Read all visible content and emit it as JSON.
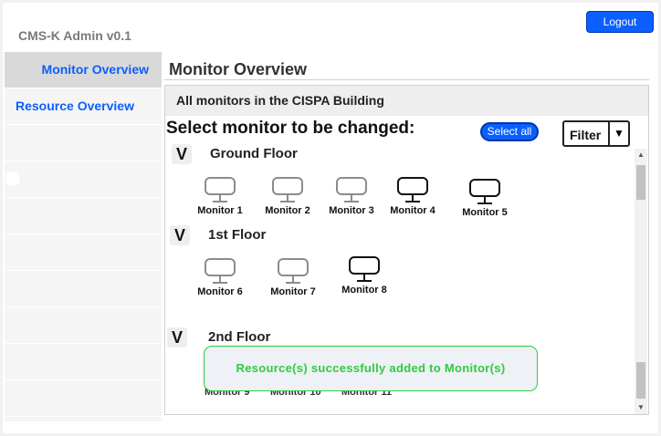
{
  "app": {
    "title": "CMS-K Admin v0.1",
    "logout_label": "Logout"
  },
  "sidebar": {
    "items": [
      {
        "label": "Monitor Overview"
      },
      {
        "label": "Resource Overview"
      }
    ]
  },
  "main": {
    "title": "Monitor Overview",
    "panel_header": "All monitors in the CISPA Building",
    "select_heading": "Select monitor to be changed:",
    "select_all_label": "Select all",
    "filter": {
      "selected": "Filter",
      "arrow": "▼"
    },
    "floors": [
      {
        "name": "Ground Floor",
        "chevron": "V",
        "monitors": [
          {
            "label": "Monitor 1",
            "status": "inactive"
          },
          {
            "label": "Monitor 2",
            "status": "inactive"
          },
          {
            "label": "Monitor 3",
            "status": "inactive"
          },
          {
            "label": "Monitor 4",
            "status": "active"
          },
          {
            "label": "Monitor 5",
            "status": "active"
          }
        ]
      },
      {
        "name": "1st Floor",
        "chevron": "V",
        "monitors": [
          {
            "label": "Monitor 6",
            "status": "inactive"
          },
          {
            "label": "Monitor 7",
            "status": "inactive"
          },
          {
            "label": "Monitor 8",
            "status": "active"
          }
        ]
      },
      {
        "name": "2nd Floor",
        "chevron": "V",
        "monitors": [
          {
            "label": "Monitor 9"
          },
          {
            "label": "Monitor 10"
          },
          {
            "label": "Monitor 11"
          }
        ]
      }
    ]
  },
  "toast": {
    "message": "Resource(s) successfully added to Monitor(s)"
  },
  "scrollbar": {
    "up_arrow": "▲",
    "down_arrow": "▼"
  },
  "colors": {
    "accent": "#0b5fff",
    "success": "#2ecc40",
    "inactive_monitor": "#8c8c8c",
    "active_monitor": "#111111"
  }
}
